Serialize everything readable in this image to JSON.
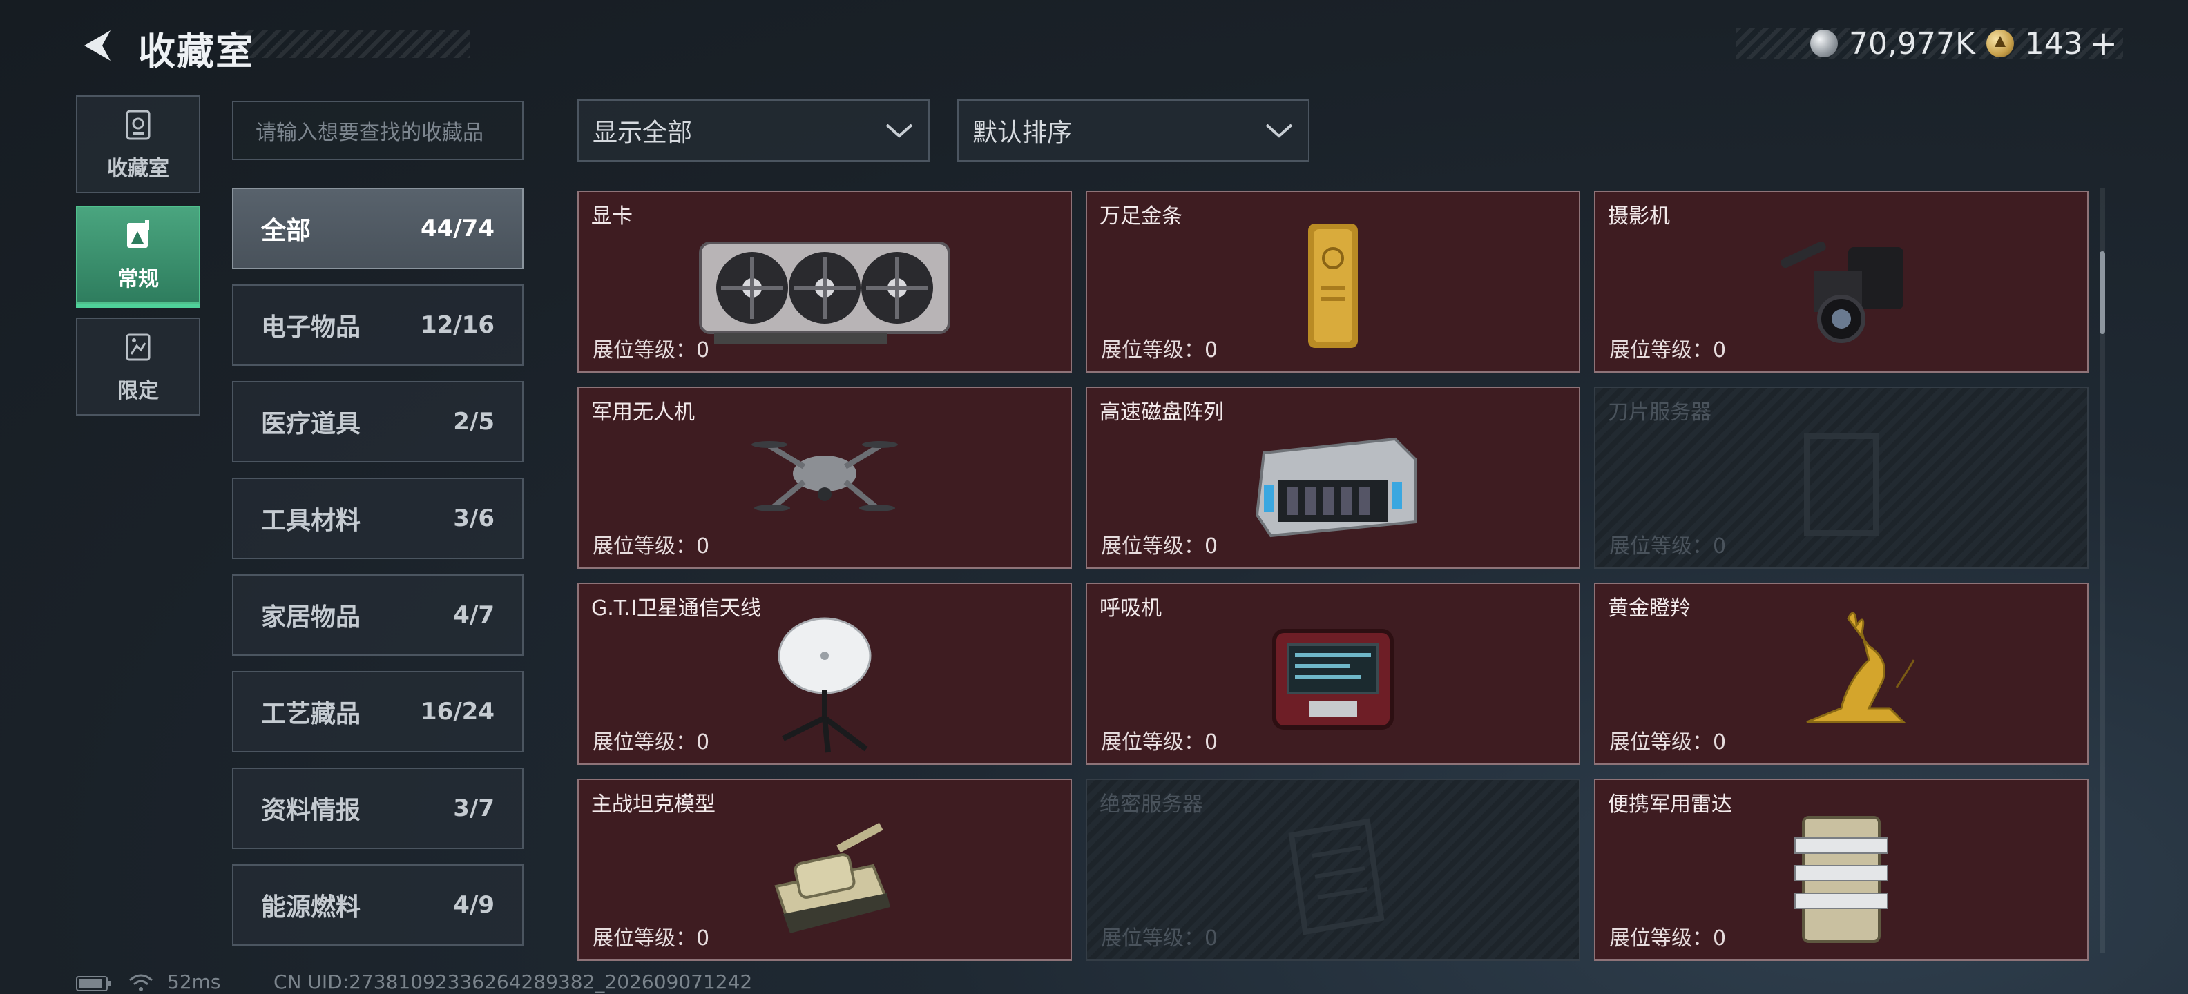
{
  "header": {
    "title": "收藏室",
    "currency": [
      {
        "icon": "silver-coin-icon",
        "value": "70,977K"
      },
      {
        "icon": "gold-coin-icon",
        "value": "143"
      }
    ],
    "add_label": "+"
  },
  "nav": {
    "tabs": [
      {
        "label": "收藏室",
        "icon": "collection-room-icon",
        "active": false
      },
      {
        "label": "常规",
        "icon": "regular-collection-icon",
        "active": true
      },
      {
        "label": "限定",
        "icon": "limited-collection-icon",
        "active": false
      }
    ]
  },
  "search": {
    "placeholder": "请输入想要查找的收藏品"
  },
  "categories": [
    {
      "name": "全部",
      "count": "44/74",
      "active": true
    },
    {
      "name": "电子物品",
      "count": "12/16"
    },
    {
      "name": "医疗道具",
      "count": "2/5"
    },
    {
      "name": "工具材料",
      "count": "3/6"
    },
    {
      "name": "家居物品",
      "count": "4/7"
    },
    {
      "name": "工艺藏品",
      "count": "16/24"
    },
    {
      "name": "资料情报",
      "count": "3/7"
    },
    {
      "name": "能源燃料",
      "count": "4/9"
    }
  ],
  "filters": {
    "show": "显示全部",
    "sort": "默认排序"
  },
  "items": [
    {
      "name": "显卡",
      "level": "展位等级：0",
      "owned": true,
      "icon": "graphics-card-icon"
    },
    {
      "name": "万足金条",
      "level": "展位等级：0",
      "owned": true,
      "icon": "gold-bar-icon"
    },
    {
      "name": "摄影机",
      "level": "展位等级：0",
      "owned": true,
      "icon": "video-camera-icon"
    },
    {
      "name": "军用无人机",
      "level": "展位等级：0",
      "owned": true,
      "icon": "drone-icon"
    },
    {
      "name": "高速磁盘阵列",
      "level": "展位等级：0",
      "owned": true,
      "icon": "disk-array-icon"
    },
    {
      "name": "刀片服务器",
      "level": "展位等级：0",
      "owned": false,
      "icon": "blade-server-icon"
    },
    {
      "name": "G.T.I卫星通信天线",
      "level": "展位等级：0",
      "owned": true,
      "icon": "satellite-antenna-icon"
    },
    {
      "name": "呼吸机",
      "level": "展位等级：0",
      "owned": true,
      "icon": "ventilator-icon"
    },
    {
      "name": "黄金瞪羚",
      "level": "展位等级：0",
      "owned": true,
      "icon": "golden-gazelle-icon"
    },
    {
      "name": "主战坦克模型",
      "level": "展位等级：0",
      "owned": true,
      "icon": "tank-model-icon"
    },
    {
      "name": "绝密服务器",
      "level": "展位等级：0",
      "owned": false,
      "icon": "secret-server-icon"
    },
    {
      "name": "便携军用雷达",
      "level": "展位等级：0",
      "owned": true,
      "icon": "portable-radar-icon"
    }
  ],
  "footer": {
    "ping": "52ms",
    "uid": "CN UID:273810923362642893​82_202609071242"
  }
}
